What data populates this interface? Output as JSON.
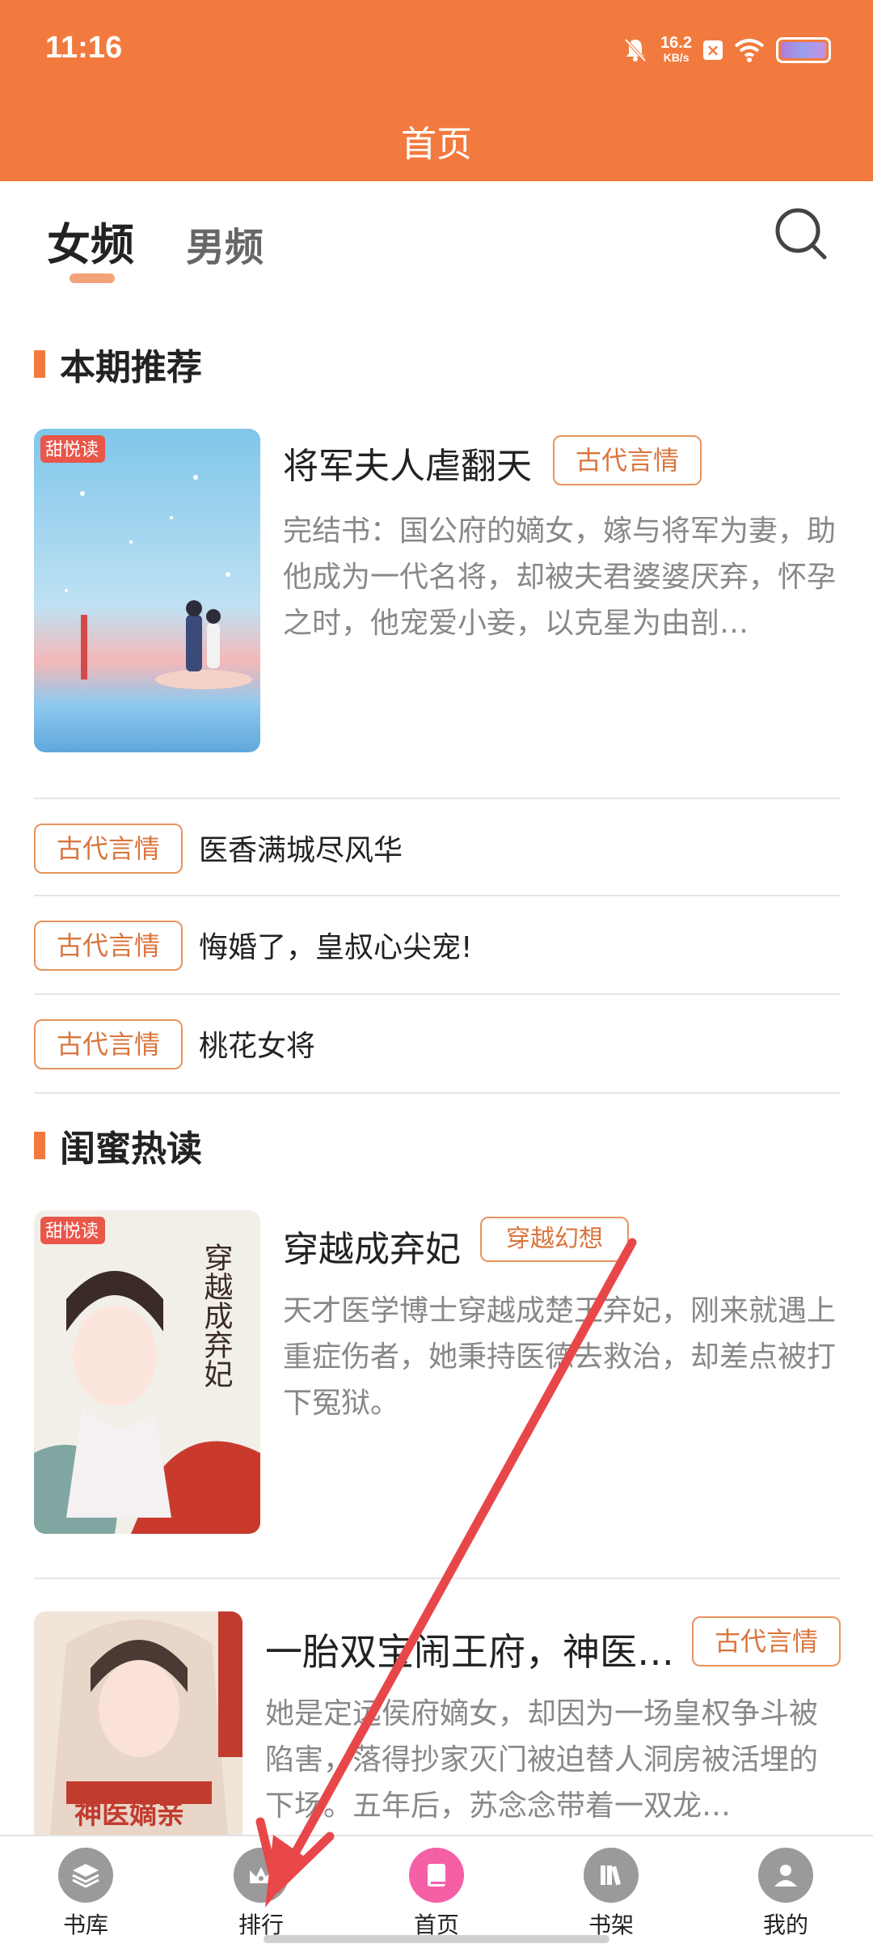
{
  "status_bar": {
    "time": "11:16",
    "net_speed": "16.2",
    "net_unit": "KB/s"
  },
  "header": {
    "title": "首页"
  },
  "tabs": [
    {
      "label": "女频",
      "active": true
    },
    {
      "label": "男频",
      "active": false
    }
  ],
  "section1": {
    "title": "本期推荐",
    "featured": {
      "title": "将军夫人虐翻天",
      "tag": "古代言情",
      "description": "完结书：国公府的嫡女，嫁与将军为妻，助他成为一代名将，却被夫君婆婆厌弃，怀孕之时，他宠爱小妾，以克星为由剖…"
    },
    "list": [
      {
        "tag": "古代言情",
        "title": "医香满城尽风华"
      },
      {
        "tag": "古代言情",
        "title": "悔婚了，皇叔心尖宠!"
      },
      {
        "tag": "古代言情",
        "title": "桃花女将"
      }
    ]
  },
  "section2": {
    "title": "闺蜜热读",
    "books": [
      {
        "title": "穿越成弃妃",
        "tag": "穿越幻想",
        "description": "天才医学博士穿越成楚王弃妃，刚来就遇上重症伤者，她秉持医德去救治，却差点被打下冤狱。",
        "cover_text": "穿越成弃妃"
      },
      {
        "title": "一胎双宝闹王府，神医…",
        "tag": "古代言情",
        "description": "她是定远侯府嫡女，却因为一场皇权争斗被陷害，落得抄家灭门被迫替人洞房被活埋的下场。五年后，苏念念带着一双龙…"
      }
    ]
  },
  "bottom_nav": [
    {
      "label": "书库",
      "icon": "layers-icon"
    },
    {
      "label": "排行",
      "icon": "crown-icon"
    },
    {
      "label": "首页",
      "icon": "book-icon",
      "active": true
    },
    {
      "label": "书架",
      "icon": "bookshelf-icon"
    },
    {
      "label": "我的",
      "icon": "user-icon"
    }
  ],
  "colors": {
    "brand": "#f27a3e",
    "tag": "#d9753d",
    "active_nav": "#f55fa6",
    "annotation_arrow": "#e8474a"
  }
}
